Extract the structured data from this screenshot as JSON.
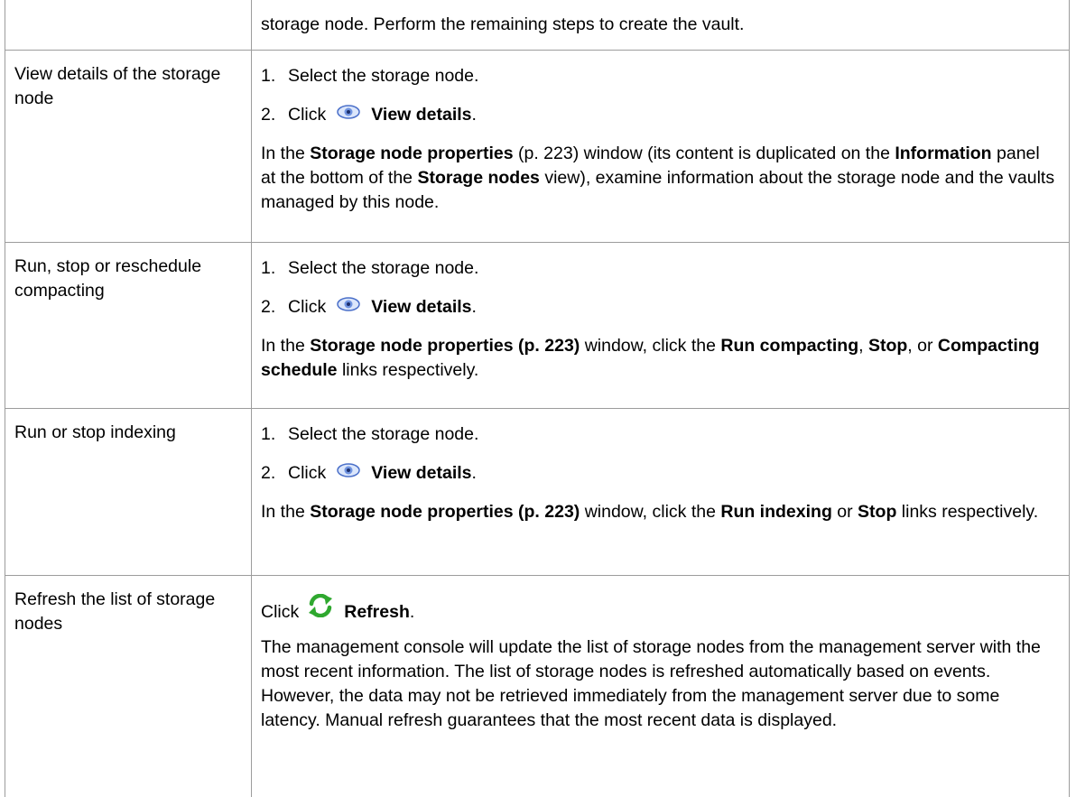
{
  "rows": [
    {
      "action": "",
      "continuation": "storage node. Perform the remaining steps to create the vault."
    },
    {
      "action": "View details of the storage node",
      "step1": {
        "num": "1.",
        "text": "Select the storage node."
      },
      "step2": {
        "num": "2.",
        "prefix": "Click",
        "icon": "view-details-icon",
        "label": "View details",
        "suffix": "."
      },
      "note": {
        "t1": "In the ",
        "b1": "Storage node properties",
        "t2": " (p. 223) window (its content is duplicated on the ",
        "b2": "Information",
        "t3": " panel at the bottom of the ",
        "b3": "Storage nodes",
        "t4": " view), examine information about the storage node and the vaults managed by this node."
      }
    },
    {
      "action": "Run, stop or reschedule compacting",
      "step1": {
        "num": "1.",
        "text": "Select the storage node."
      },
      "step2": {
        "num": "2.",
        "prefix": "Click",
        "icon": "view-details-icon",
        "label": "View details",
        "suffix": "."
      },
      "note": {
        "t1": "In the ",
        "b1": "Storage node properties (p. 223)",
        "t2": " window, click the ",
        "b2": "Run compacting",
        "t3": ", ",
        "b3": "Stop",
        "t4": ", or ",
        "b4": "Compacting schedule",
        "t5": " links respectively."
      }
    },
    {
      "action": "Run or stop indexing",
      "step1": {
        "num": "1.",
        "text": "Select the storage node."
      },
      "step2": {
        "num": "2.",
        "prefix": "Click",
        "icon": "view-details-icon",
        "label": "View details",
        "suffix": "."
      },
      "note": {
        "t1": "In the ",
        "b1": "Storage node properties (p. 223)",
        "t2": " window, click the ",
        "b2": "Run indexing",
        "t3": " or ",
        "b3": "Stop",
        "t4": " links respectively."
      }
    },
    {
      "action": "Refresh the list of storage nodes",
      "step": {
        "prefix": "Click",
        "icon": "refresh-icon",
        "label": "Refresh",
        "suffix": "."
      },
      "note": "The management console will update the list of storage nodes from the management server with the most recent information. The list of storage nodes is refreshed automatically based on events. However, the data may not be retrieved immediately from the management server due to some latency. Manual refresh guarantees that the most recent data is displayed."
    }
  ],
  "colors": {
    "border": "#9c9c9c",
    "text": "#000000",
    "eye_icon": "#4a6fc9",
    "refresh_icon": "#2fa82f"
  }
}
